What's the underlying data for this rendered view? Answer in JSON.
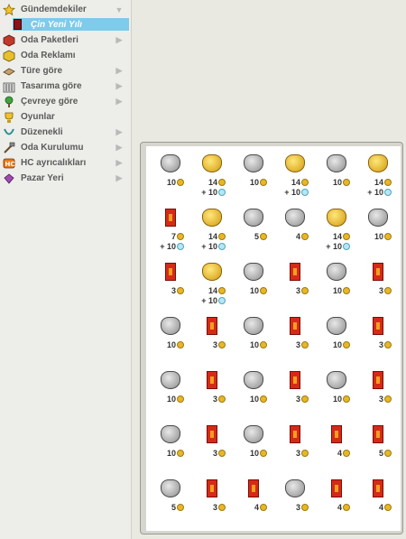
{
  "sidebar": {
    "categories": [
      {
        "label": "Gündemdekiler",
        "icon": "star-icon",
        "expanded": true
      },
      {
        "label": "Oda Paketleri",
        "icon": "room-bundle-icon"
      },
      {
        "label": "Oda Reklamı",
        "icon": "room-ad-icon"
      },
      {
        "label": "Türe göre",
        "icon": "type-icon"
      },
      {
        "label": "Tasarıma göre",
        "icon": "design-icon"
      },
      {
        "label": "Çevreye göre",
        "icon": "environment-icon"
      },
      {
        "label": "Oyunlar",
        "icon": "games-icon"
      },
      {
        "label": "Düzenekli",
        "icon": "wired-icon"
      },
      {
        "label": "Oda Kurulumu",
        "icon": "room-setup-icon"
      },
      {
        "label": "HC ayrıcalıkları",
        "icon": "hc-icon"
      },
      {
        "label": "Pazar Yeri",
        "icon": "marketplace-icon"
      }
    ],
    "selected_sub": "Çin Yeni Yılı"
  },
  "catalog": {
    "items": [
      {
        "price": "10"
      },
      {
        "price": "14",
        "diamonds": "+ 10"
      },
      {
        "price": "10"
      },
      {
        "price": "14",
        "diamonds": "+ 10"
      },
      {
        "price": "10"
      },
      {
        "price": "14",
        "diamonds": "+ 10"
      },
      {
        "price": "7",
        "diamonds": "+ 10"
      },
      {
        "price": "14",
        "diamonds": "+ 10"
      },
      {
        "price": "5"
      },
      {
        "price": "4"
      },
      {
        "price": "14",
        "diamonds": "+ 10"
      },
      {
        "price": "10"
      },
      {
        "price": "3"
      },
      {
        "price": "14",
        "diamonds": "+ 10"
      },
      {
        "price": "10"
      },
      {
        "price": "3"
      },
      {
        "price": "10"
      },
      {
        "price": "3"
      },
      {
        "price": "10"
      },
      {
        "price": "3"
      },
      {
        "price": "10"
      },
      {
        "price": "3"
      },
      {
        "price": "10"
      },
      {
        "price": "3"
      },
      {
        "price": "10"
      },
      {
        "price": "3"
      },
      {
        "price": "10"
      },
      {
        "price": "3"
      },
      {
        "price": "10"
      },
      {
        "price": "3"
      },
      {
        "price": "10"
      },
      {
        "price": "3"
      },
      {
        "price": "10"
      },
      {
        "price": "3"
      },
      {
        "price": "4"
      },
      {
        "price": "5"
      },
      {
        "price": "5"
      },
      {
        "price": "3"
      },
      {
        "price": "4"
      },
      {
        "price": "3"
      },
      {
        "price": "4"
      },
      {
        "price": "4"
      }
    ]
  }
}
